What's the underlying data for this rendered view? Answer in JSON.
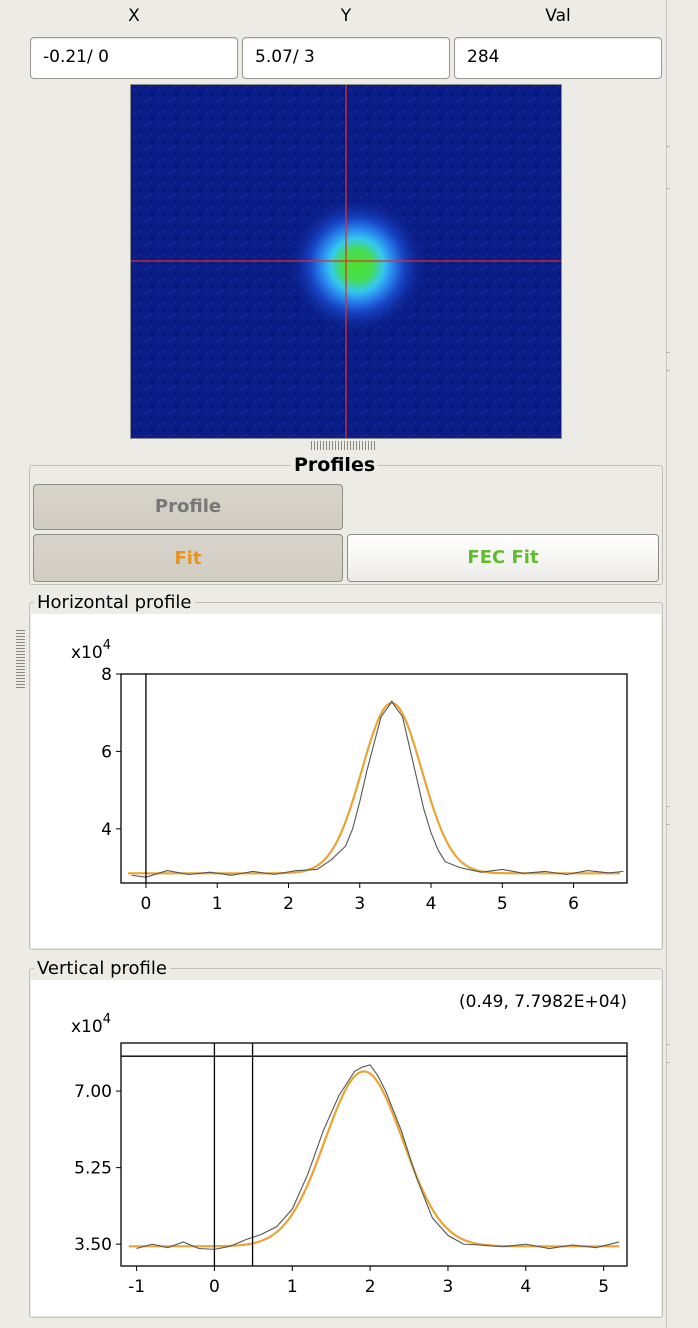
{
  "coords": {
    "x_label": "X",
    "y_label": "Y",
    "val_label": "Val",
    "x_value": "-0.21/  0",
    "y_value": "5.07/  3",
    "val_value": "284"
  },
  "profiles": {
    "group_title": "Profiles",
    "profile_button": "Profile",
    "fit_button": "Fit",
    "fec_fit_button": "FEC Fit"
  },
  "colors": {
    "profile_text": "#777777",
    "fit_text": "#e8931e",
    "fec_fit_text": "#5ebd2a",
    "fit_curve": "#e8a533",
    "crosshair": "#e03020"
  },
  "horizontal": {
    "group_title": "Horizontal profile",
    "multiplier_base": "x10",
    "multiplier_exp": "4"
  },
  "vertical": {
    "group_title": "Vertical profile",
    "multiplier_base": "x10",
    "multiplier_exp": "4",
    "cursor_readout": "(0.49, 7.7982E+04)"
  },
  "chart_data": [
    {
      "type": "line",
      "name": "horizontal-profile",
      "xlim": [
        -0.35,
        6.75
      ],
      "ylim": [
        2.6,
        8.0
      ],
      "x_ticks": [
        0,
        1,
        2,
        3,
        4,
        5,
        6
      ],
      "x_tick_labels": [
        "0",
        "1",
        "2",
        "3",
        "4",
        "5",
        "6"
      ],
      "y_ticks": [
        4,
        6,
        8
      ],
      "y_tick_labels": [
        "4",
        "6",
        "8"
      ],
      "cursor_x": [
        0
      ],
      "fit": {
        "baseline": 2.85,
        "amplitude": 4.4,
        "center": 3.45,
        "sigma": 0.42
      },
      "series": [
        {
          "x": [
            -0.2,
            0.0,
            0.3,
            0.6,
            0.9,
            1.2,
            1.5,
            1.8,
            2.1,
            2.4,
            2.6,
            2.8,
            2.9,
            3.0,
            3.1,
            3.2,
            3.3,
            3.4,
            3.45,
            3.5,
            3.6,
            3.7,
            3.8,
            3.9,
            4.0,
            4.1,
            4.2,
            4.4,
            4.7,
            5.0,
            5.3,
            5.6,
            5.9,
            6.2,
            6.5,
            6.7
          ],
          "y": [
            2.8,
            2.75,
            2.92,
            2.82,
            2.88,
            2.8,
            2.9,
            2.82,
            2.92,
            2.95,
            3.2,
            3.55,
            4.0,
            4.7,
            5.5,
            6.2,
            6.9,
            7.15,
            7.3,
            7.15,
            6.9,
            6.1,
            5.3,
            4.5,
            3.9,
            3.45,
            3.15,
            3.0,
            2.88,
            2.95,
            2.85,
            2.9,
            2.82,
            2.92,
            2.86,
            2.9
          ]
        }
      ]
    },
    {
      "type": "line",
      "name": "vertical-profile",
      "xlim": [
        -1.2,
        5.3
      ],
      "ylim": [
        3.0,
        8.1
      ],
      "x_ticks": [
        -1,
        0,
        1,
        2,
        3,
        4,
        5
      ],
      "x_tick_labels": [
        "-1",
        "0",
        "1",
        "2",
        "3",
        "4",
        "5"
      ],
      "y_ticks": [
        3.5,
        5.25,
        7.0
      ],
      "y_tick_labels": [
        "3.50",
        "5.25",
        "7.00"
      ],
      "cursor_x": [
        0,
        0.49
      ],
      "cursor_y": 7.7982,
      "fit": {
        "baseline": 3.45,
        "amplitude": 4.0,
        "center": 1.92,
        "sigma": 0.5
      },
      "series": [
        {
          "x": [
            -1.0,
            -0.8,
            -0.6,
            -0.4,
            -0.2,
            0.0,
            0.2,
            0.4,
            0.6,
            0.8,
            1.0,
            1.2,
            1.4,
            1.6,
            1.8,
            1.9,
            2.0,
            2.1,
            2.2,
            2.4,
            2.6,
            2.8,
            3.0,
            3.2,
            3.4,
            3.7,
            4.0,
            4.3,
            4.6,
            4.9,
            5.2
          ],
          "y": [
            3.4,
            3.5,
            3.42,
            3.55,
            3.4,
            3.38,
            3.45,
            3.6,
            3.72,
            3.9,
            4.3,
            5.1,
            6.1,
            6.9,
            7.45,
            7.55,
            7.6,
            7.35,
            7.0,
            6.1,
            5.0,
            4.1,
            3.7,
            3.5,
            3.48,
            3.44,
            3.5,
            3.4,
            3.48,
            3.42,
            3.55
          ]
        }
      ]
    }
  ]
}
